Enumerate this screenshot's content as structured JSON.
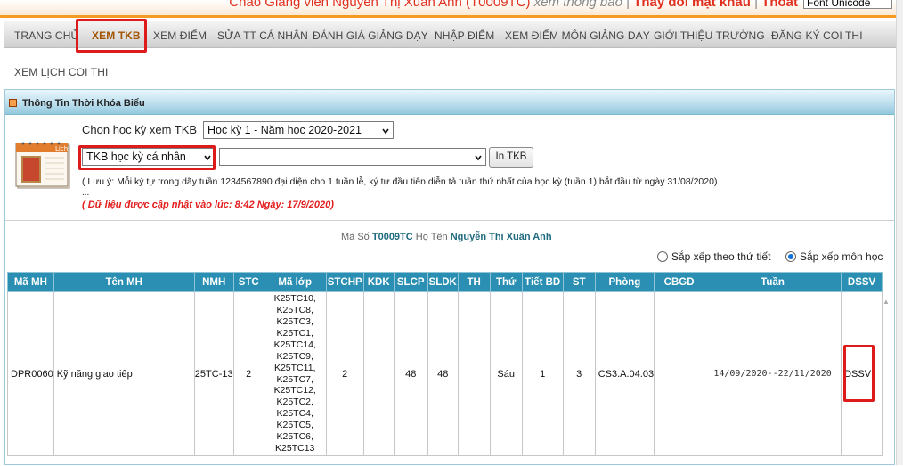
{
  "top_bar": {
    "greeting_prefix": "Chào Giảng viên Nguyễn Thị Xuân Anh (T0009TC)",
    "view_info": "xem thông báo",
    "separator": "|",
    "change_password": "Thay đổi mật khẩu",
    "logout": "Thoát",
    "font_select_value": "Font Unicode"
  },
  "nav": {
    "items": [
      "TRANG CHỦ",
      "XEM TKB",
      "XEM ĐIỂM",
      "SỬA TT CÁ NHÂN",
      "ĐÁNH GIÁ GIẢNG DẠY",
      "NHẬP ĐIỂM",
      "XEM ĐIỂM MÔN GIẢNG DẠY",
      "GIỚI THIỆU TRƯỜNG",
      "ĐĂNG KÝ COI THI",
      "XEM LỊCH COI THI"
    ],
    "active": "XEM TKB"
  },
  "panel": {
    "title": "Thông Tin Thời Khóa Biểu",
    "calendar_label": "Lịch",
    "term_label": "Chọn học kỳ xem TKB",
    "term_select": "Học kỳ 1 - Năm học 2020-2021",
    "type_select": "TKB học kỳ cá nhân",
    "second_select": "",
    "print_button": "In TKB",
    "note": "( Lưu ý: Mỗi ký tự trong dãy tuần 1234567890 đại diện cho 1 tuần lễ, ký tự đầu tiên diễn tả tuần thứ nhất của học kỳ (tuần 1) bắt đầu từ ngày 31/08/2020)",
    "ellipsis": "...",
    "update_notice": "( Dữ liệu được cập nhật vào lúc: 8:42 Ngày: 17/9/2020)"
  },
  "student": {
    "code_label": "Mã Số",
    "code": "T0009TC",
    "name_label": "Họ Tên",
    "name": "Nguyễn Thị Xuân Anh"
  },
  "sort": {
    "by_day": "Sắp xếp theo thứ tiết",
    "by_subject": "Sắp xếp môn học",
    "selected": "by_subject"
  },
  "table": {
    "headers": [
      "Mã MH",
      "Tên MH",
      "NMH",
      "STC",
      "Mã lớp",
      "STCHP",
      "KDK",
      "SLCP",
      "SLDK",
      "TH",
      "Thứ",
      "Tiết BD",
      "ST",
      "Phòng",
      "CBGD",
      "Tuần",
      "DSSV"
    ],
    "row": {
      "ma_mh": "DPR0060",
      "ten_mh": "Kỹ năng giao tiếp",
      "nmh": "25TC-13",
      "stc": "2",
      "ma_lop": [
        "K25TC10,",
        "K25TC8,",
        "K25TC3,",
        "K25TC1,",
        "K25TC14,",
        "K25TC9,",
        "K25TC11,",
        "K25TC7,",
        "K25TC12,",
        "K25TC2,",
        "K25TC4,",
        "K25TC5,",
        "K25TC6,",
        "K25TC13"
      ],
      "stchp": "2",
      "kdk": "",
      "slcp": "48",
      "sldk": "48",
      "th": "",
      "thu": "Sáu",
      "tiet_bd": "1",
      "st": "3",
      "phong": "CS3.A.04.03",
      "cbgd": "",
      "tuan": "14/09/2020--22/11/2020",
      "dssv": "DSSV"
    }
  }
}
